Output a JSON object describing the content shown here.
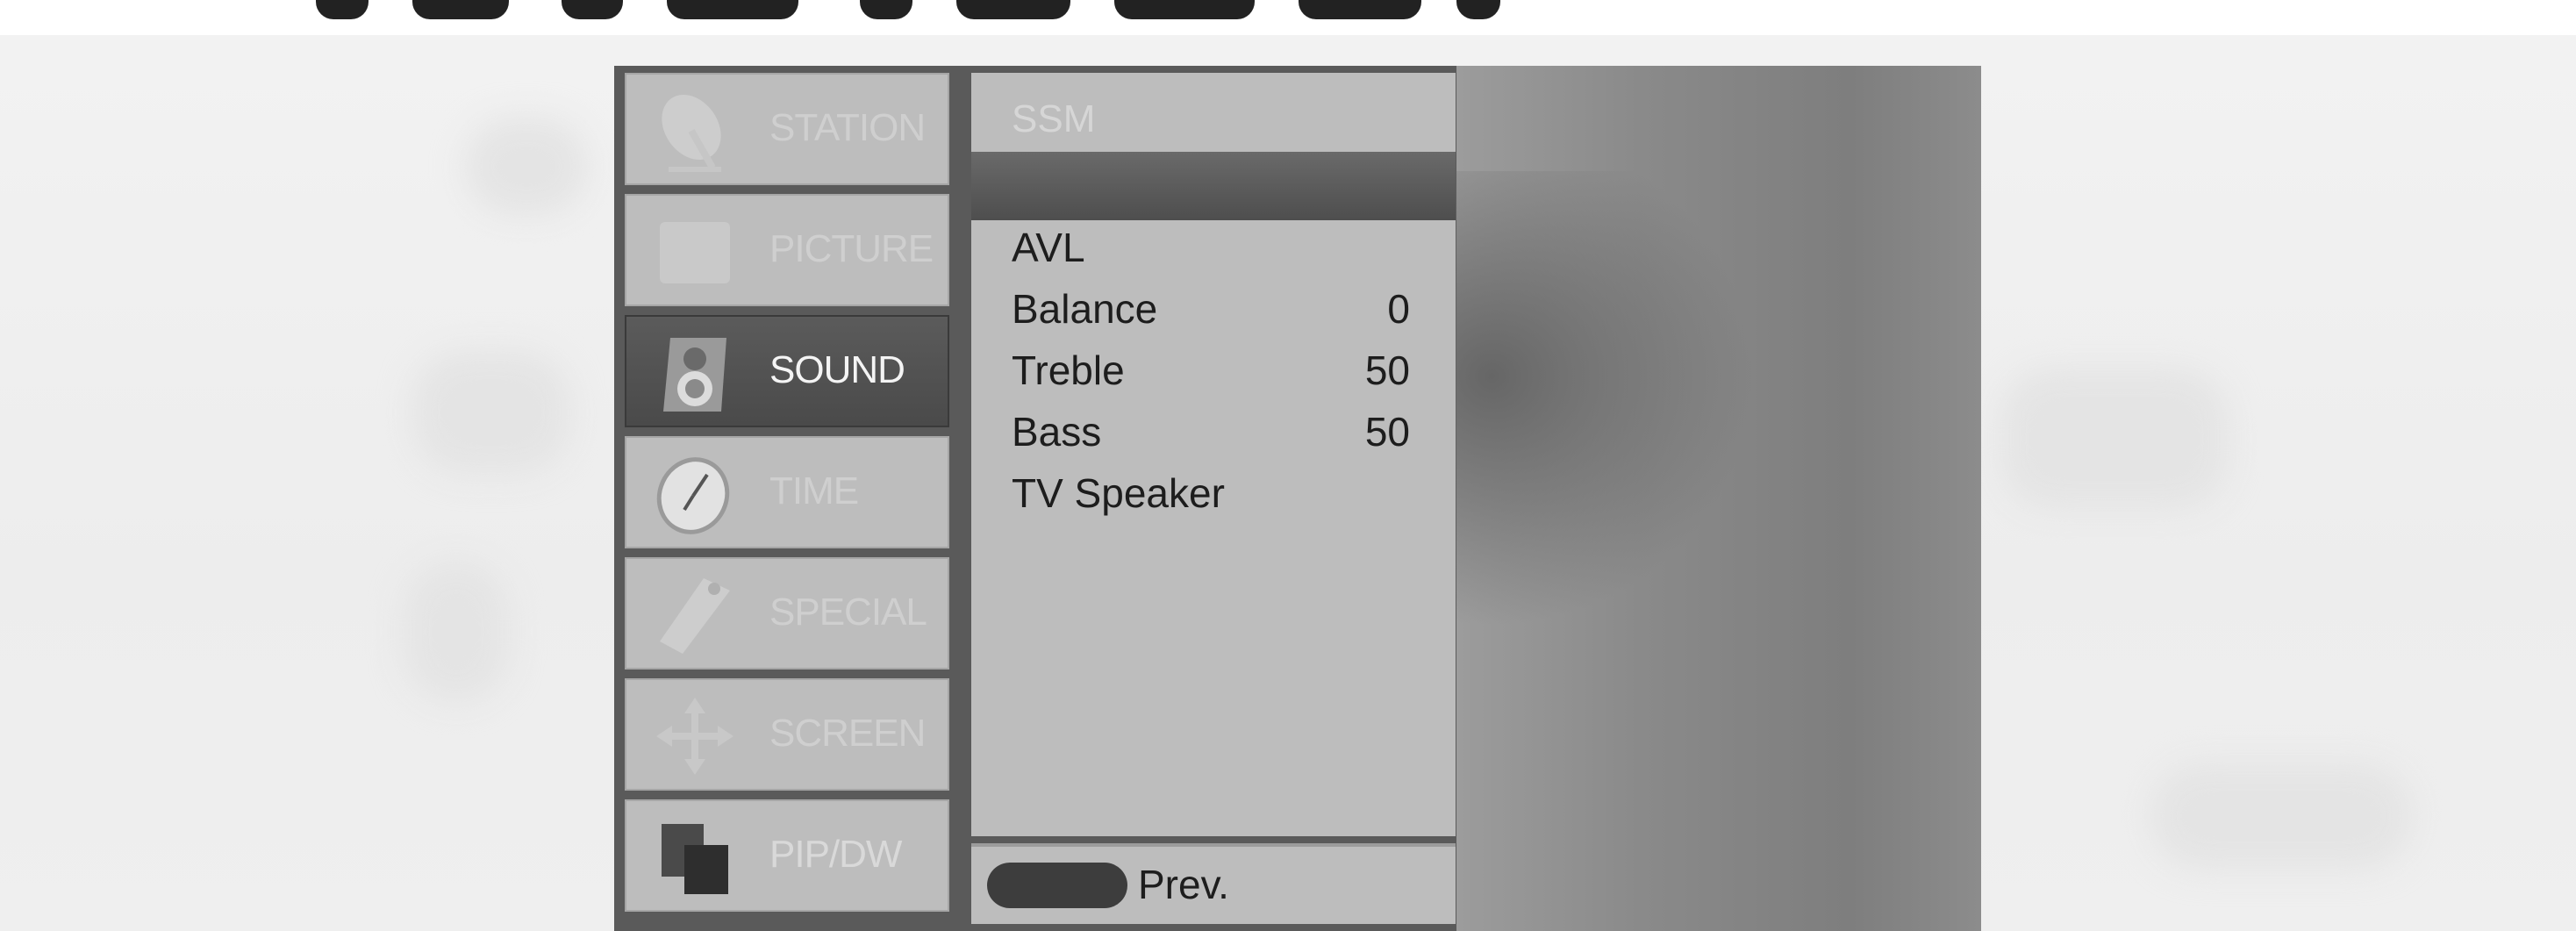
{
  "menu": {
    "categories": [
      {
        "label": "STATION",
        "icon": "satellite-dish-icon",
        "state": "dim"
      },
      {
        "label": "PICTURE",
        "icon": "picture-icon",
        "state": "dim"
      },
      {
        "label": "SOUND",
        "icon": "speaker-icon",
        "state": "active"
      },
      {
        "label": "TIME",
        "icon": "clock-icon",
        "state": "dim"
      },
      {
        "label": "SPECIAL",
        "icon": "tag-icon",
        "state": "dim"
      },
      {
        "label": "SCREEN",
        "icon": "move-arrows-icon",
        "state": "dim"
      },
      {
        "label": "PIP/DW",
        "icon": "pip-windows-icon",
        "state": "normal"
      }
    ],
    "submenu_header": "SSM",
    "items": [
      {
        "label": "AVL",
        "value": ""
      },
      {
        "label": "Balance",
        "value": "0"
      },
      {
        "label": "Treble",
        "value": "50"
      },
      {
        "label": "Bass",
        "value": "50"
      },
      {
        "label": "TV Speaker",
        "value": ""
      }
    ],
    "prev_label": "Prev."
  },
  "colors": {
    "panel": "#bdbdbd",
    "active": "#4f4f4f",
    "text": "#1d1d1d"
  }
}
